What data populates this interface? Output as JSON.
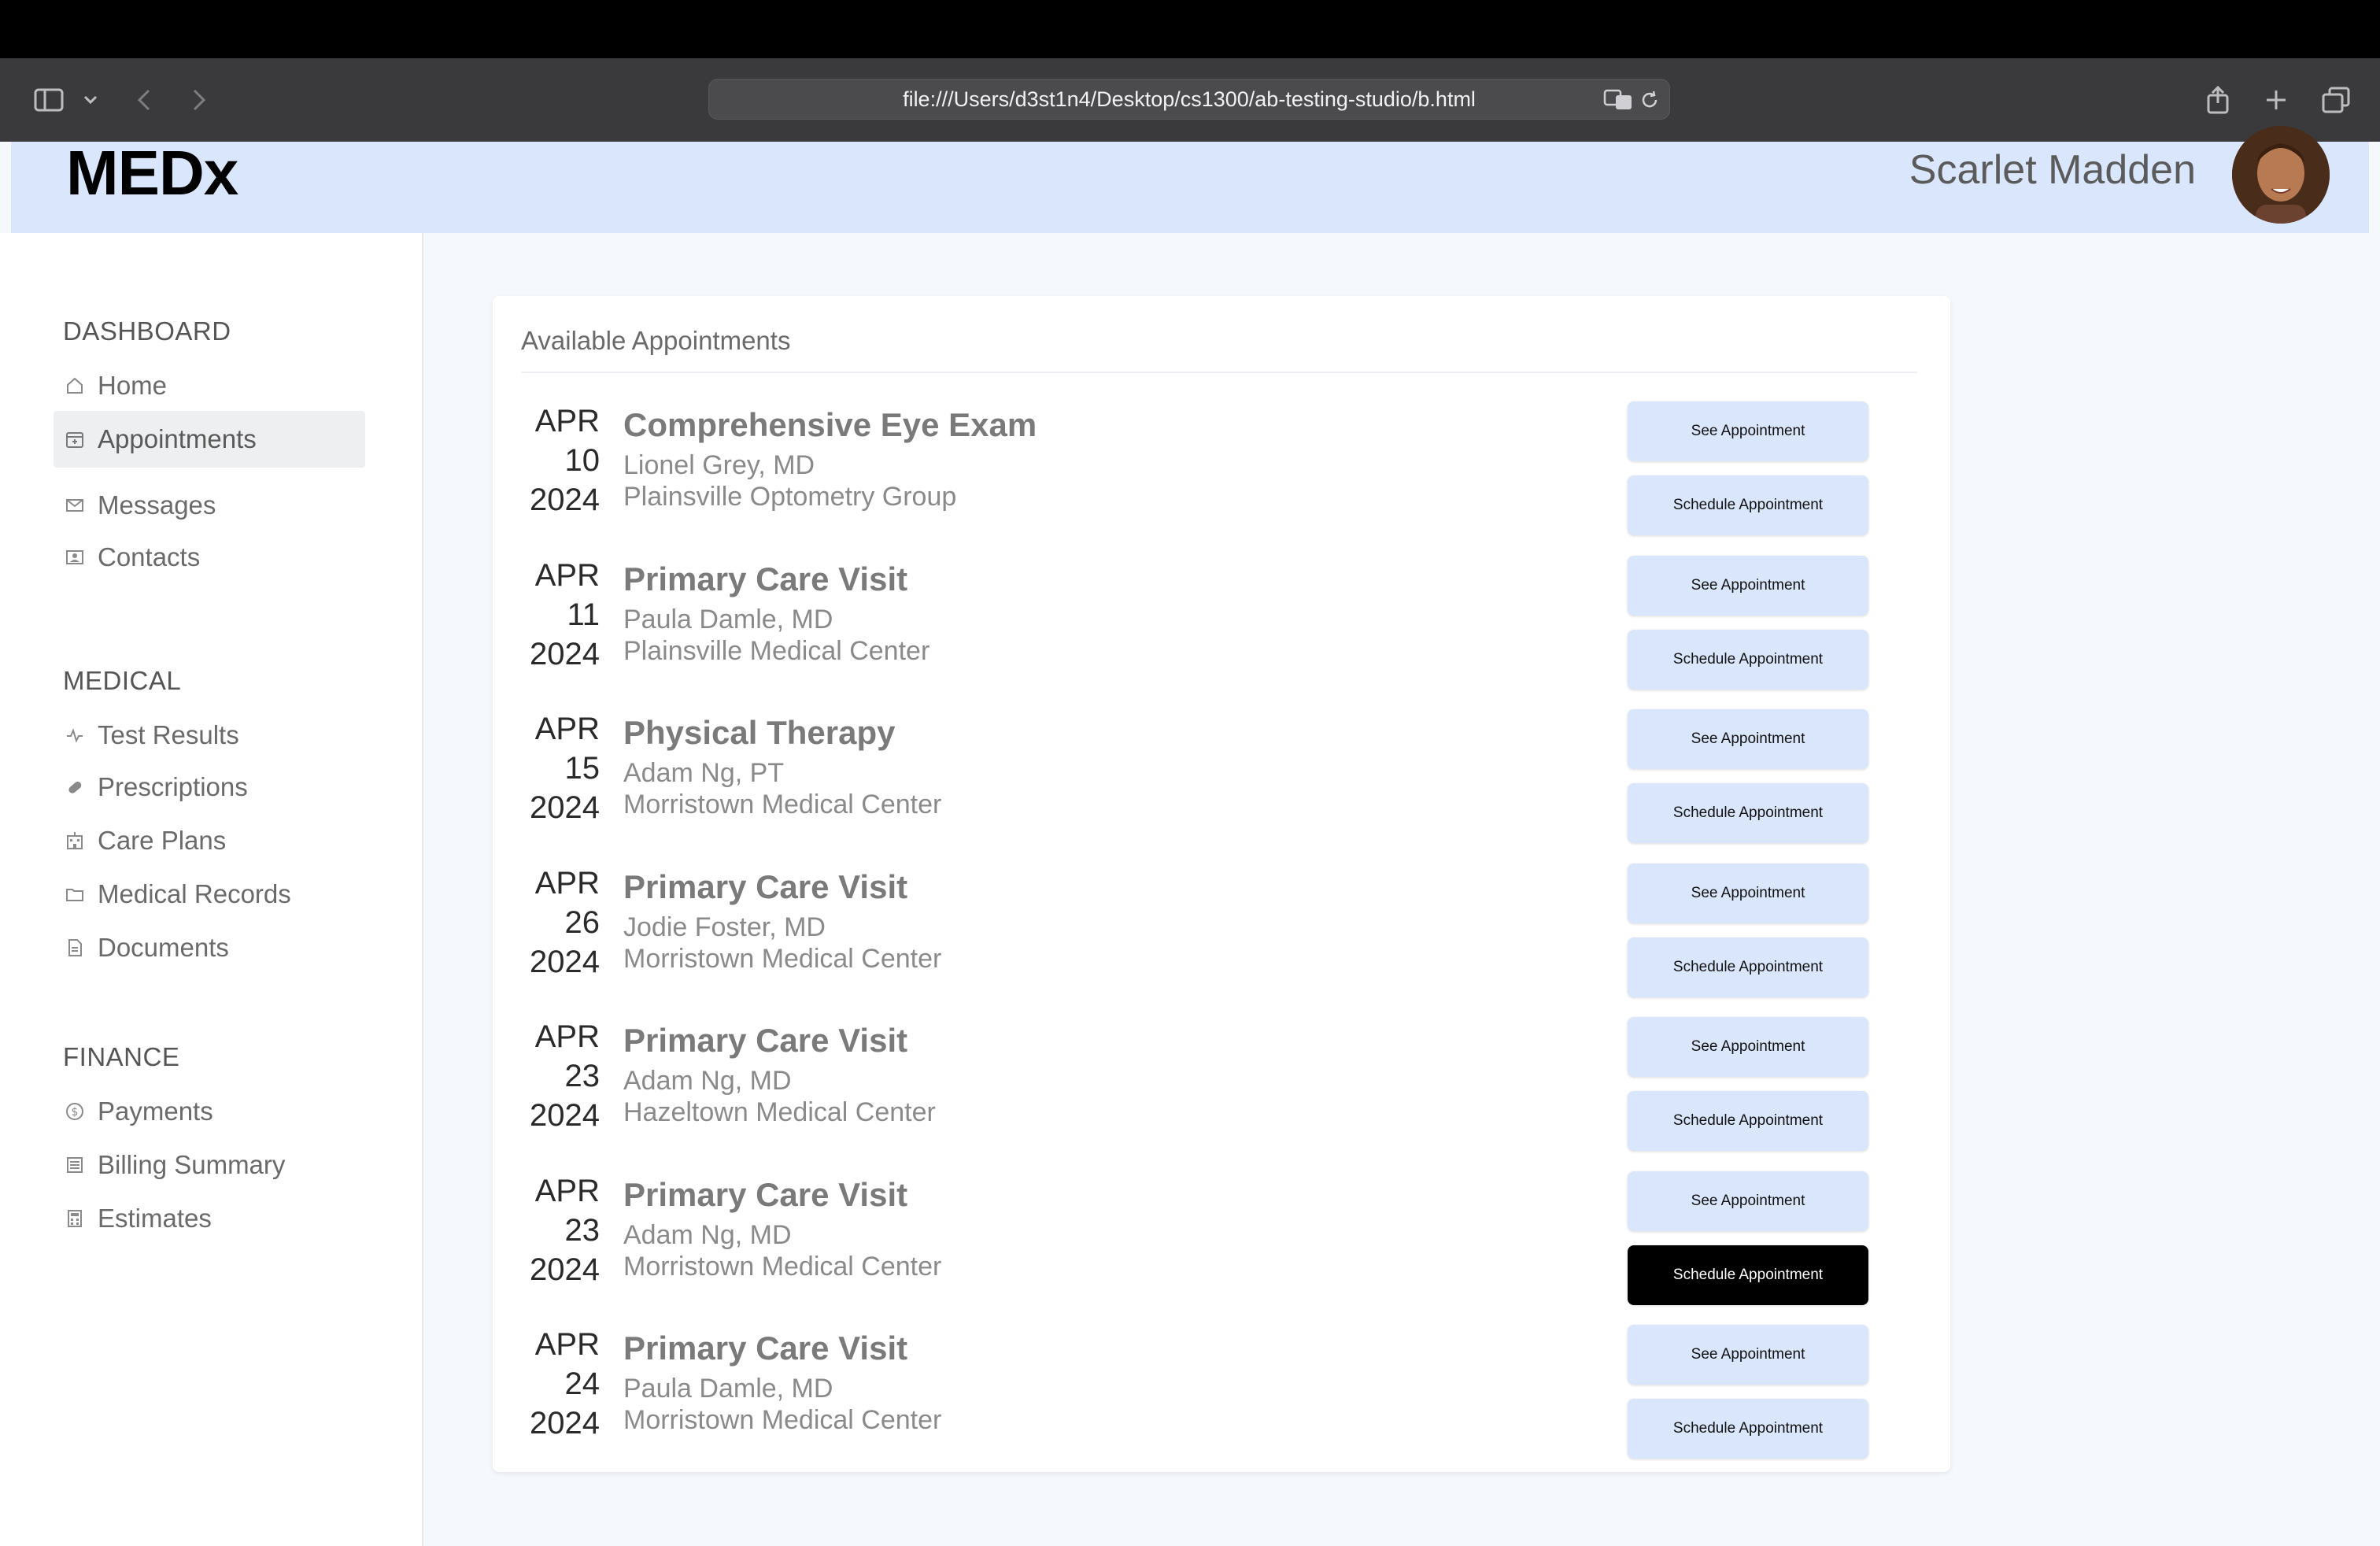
{
  "browser": {
    "url": "file:///Users/d3st1n4/Desktop/cs1300/ab-testing-studio/b.html"
  },
  "header": {
    "logo": "MEDx",
    "user_name": "Scarlet Madden"
  },
  "sidebar": {
    "sections": [
      {
        "heading": "DASHBOARD",
        "items": [
          {
            "label": "Home",
            "icon": "home-icon"
          },
          {
            "label": "Appointments",
            "icon": "calendar-icon",
            "active": true
          },
          {
            "label": "Messages",
            "icon": "envelope-icon"
          },
          {
            "label": "Contacts",
            "icon": "contact-card-icon"
          }
        ]
      },
      {
        "heading": "MEDICAL",
        "items": [
          {
            "label": "Test Results",
            "icon": "pulse-icon"
          },
          {
            "label": "Prescriptions",
            "icon": "pill-icon"
          },
          {
            "label": "Care Plans",
            "icon": "hospital-icon"
          },
          {
            "label": "Medical Records",
            "icon": "folder-icon"
          },
          {
            "label": "Documents",
            "icon": "document-icon"
          }
        ]
      },
      {
        "heading": "FINANCE",
        "items": [
          {
            "label": "Payments",
            "icon": "dollar-coin-icon"
          },
          {
            "label": "Billing Summary",
            "icon": "list-icon"
          },
          {
            "label": "Estimates",
            "icon": "calculator-icon"
          }
        ]
      }
    ]
  },
  "main": {
    "title": "Available Appointments",
    "see_label": "See Appointment",
    "schedule_label": "Schedule Appointment",
    "appointments": [
      {
        "month": "APR",
        "day": "10",
        "year": "2024",
        "title": "Comprehensive Eye Exam",
        "doctor": "Lionel Grey, MD",
        "location": "Plainsville Optometry Group"
      },
      {
        "month": "APR",
        "day": "11",
        "year": "2024",
        "title": "Primary Care Visit",
        "doctor": "Paula Damle, MD",
        "location": "Plainsville Medical Center"
      },
      {
        "month": "APR",
        "day": "15",
        "year": "2024",
        "title": "Physical Therapy",
        "doctor": "Adam Ng, PT",
        "location": "Morristown Medical Center"
      },
      {
        "month": "APR",
        "day": "26",
        "year": "2024",
        "title": "Primary Care Visit",
        "doctor": "Jodie Foster, MD",
        "location": "Morristown Medical Center"
      },
      {
        "month": "APR",
        "day": "23",
        "year": "2024",
        "title": "Primary Care Visit",
        "doctor": "Adam Ng, MD",
        "location": "Hazeltown Medical Center"
      },
      {
        "month": "APR",
        "day": "23",
        "year": "2024",
        "title": "Primary Care Visit",
        "doctor": "Adam Ng, MD",
        "location": "Morristown Medical Center",
        "schedule_highlighted": true
      },
      {
        "month": "APR",
        "day": "24",
        "year": "2024",
        "title": "Primary Care Visit",
        "doctor": "Paula Damle, MD",
        "location": "Morristown Medical Center"
      }
    ]
  }
}
